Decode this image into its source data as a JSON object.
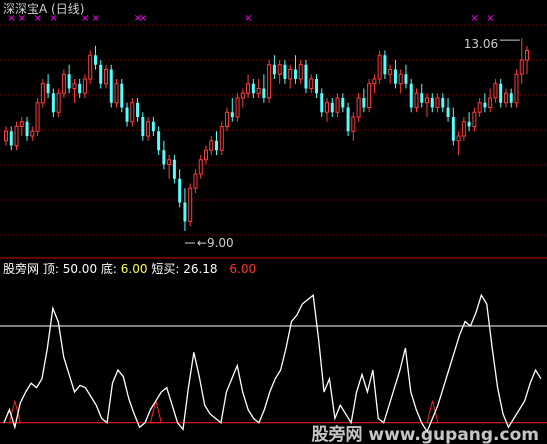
{
  "window": {
    "title": "深深宝A (日线)",
    "watermark": "股旁网 www.gupang.com"
  },
  "indicator_bar": {
    "name": "股旁网",
    "top_label": "顶:",
    "top_value": "50.00",
    "bottom_label": "底:",
    "bottom_value": "6.00",
    "short_label": "短买:",
    "short_value": "26.18",
    "extra_value": "6.00"
  },
  "colors": {
    "background": "#000000",
    "up_candle": "#ff3b3b",
    "down_candle": "#54ffff",
    "grid": "#8b0000",
    "indicator_line": "#ffffff",
    "marker": "#ff00ff",
    "bottom_fill": "#ff2020",
    "top_color": "#ffffff",
    "bottom_color": "#ffff40",
    "extra_color": "#ff3030"
  },
  "chart_data": [
    {
      "type": "candlestick",
      "title": "深深宝A (日线)",
      "annotations": [
        {
          "text": "13.06",
          "kind": "high"
        },
        {
          "text": "9.00",
          "kind": "low"
        }
      ],
      "ylim": [
        8.6,
        13.4
      ],
      "grid": true,
      "series": [
        {
          "values": [
            [
              10.9,
              11.2,
              10.8,
              11.1
            ],
            [
              11.1,
              11.2,
              10.7,
              10.8
            ],
            [
              10.8,
              11.3,
              10.7,
              11.2
            ],
            [
              11.2,
              11.4,
              11.0,
              11.3
            ],
            [
              11.3,
              11.4,
              10.9,
              11.0
            ],
            [
              11.0,
              11.2,
              10.9,
              11.1
            ],
            [
              11.1,
              11.8,
              11.0,
              11.7
            ],
            [
              11.7,
              12.2,
              11.6,
              12.1
            ],
            [
              12.1,
              12.3,
              11.8,
              11.9
            ],
            [
              11.9,
              12.0,
              11.4,
              11.5
            ],
            [
              11.5,
              12.0,
              11.4,
              11.9
            ],
            [
              11.9,
              12.4,
              11.8,
              12.3
            ],
            [
              12.3,
              12.5,
              11.9,
              12.0
            ],
            [
              12.0,
              12.2,
              11.7,
              12.1
            ],
            [
              12.1,
              12.2,
              11.8,
              11.9
            ],
            [
              11.9,
              12.3,
              11.8,
              12.2
            ],
            [
              12.2,
              12.8,
              12.1,
              12.7
            ],
            [
              12.7,
              12.9,
              12.4,
              12.5
            ],
            [
              12.5,
              12.6,
              12.0,
              12.1
            ],
            [
              12.1,
              12.5,
              12.0,
              12.4
            ],
            [
              12.4,
              12.5,
              11.6,
              11.7
            ],
            [
              11.7,
              12.2,
              11.6,
              12.1
            ],
            [
              12.1,
              12.2,
              11.5,
              11.6
            ],
            [
              11.6,
              11.7,
              11.2,
              11.3
            ],
            [
              11.3,
              11.8,
              11.2,
              11.7
            ],
            [
              11.7,
              11.8,
              11.3,
              11.4
            ],
            [
              11.4,
              11.5,
              10.9,
              11.0
            ],
            [
              11.0,
              11.4,
              10.9,
              11.3
            ],
            [
              11.3,
              11.4,
              11.0,
              11.1
            ],
            [
              11.1,
              11.2,
              10.6,
              10.7
            ],
            [
              10.7,
              10.9,
              10.3,
              10.4
            ],
            [
              10.4,
              10.6,
              10.1,
              10.5
            ],
            [
              10.5,
              10.6,
              10.0,
              10.1
            ],
            [
              10.1,
              10.3,
              9.5,
              9.6
            ],
            [
              9.6,
              9.9,
              9.0,
              9.2
            ],
            [
              9.2,
              10.0,
              9.1,
              9.9
            ],
            [
              9.9,
              10.3,
              9.8,
              10.2
            ],
            [
              10.2,
              10.6,
              10.1,
              10.5
            ],
            [
              10.5,
              10.8,
              10.4,
              10.7
            ],
            [
              10.7,
              11.0,
              10.6,
              10.9
            ],
            [
              10.9,
              11.1,
              10.6,
              10.7
            ],
            [
              10.7,
              11.3,
              10.6,
              11.2
            ],
            [
              11.2,
              11.6,
              11.1,
              11.5
            ],
            [
              11.5,
              11.8,
              11.3,
              11.4
            ],
            [
              11.4,
              11.9,
              11.3,
              11.8
            ],
            [
              11.8,
              12.0,
              11.6,
              11.9
            ],
            [
              11.9,
              12.3,
              11.8,
              12.1
            ],
            [
              12.1,
              12.2,
              11.8,
              11.9
            ],
            [
              11.9,
              12.2,
              11.8,
              12.0
            ],
            [
              12.0,
              12.3,
              11.7,
              11.8
            ],
            [
              11.8,
              12.6,
              11.7,
              12.5
            ],
            [
              12.5,
              12.7,
              12.2,
              12.3
            ],
            [
              12.3,
              12.6,
              12.1,
              12.5
            ],
            [
              12.5,
              12.6,
              12.1,
              12.2
            ],
            [
              12.2,
              12.5,
              12.0,
              12.4
            ],
            [
              12.4,
              12.7,
              12.1,
              12.2
            ],
            [
              12.2,
              12.6,
              12.1,
              12.5
            ],
            [
              12.5,
              12.6,
              11.9,
              12.0
            ],
            [
              12.0,
              12.3,
              11.9,
              12.2
            ],
            [
              12.2,
              12.3,
              11.8,
              11.9
            ],
            [
              11.9,
              12.0,
              11.4,
              11.5
            ],
            [
              11.5,
              11.8,
              11.3,
              11.7
            ],
            [
              11.7,
              11.8,
              11.4,
              11.5
            ],
            [
              11.5,
              11.9,
              11.4,
              11.8
            ],
            [
              11.8,
              11.9,
              11.5,
              11.6
            ],
            [
              11.6,
              11.7,
              11.0,
              11.1
            ],
            [
              11.1,
              11.5,
              10.9,
              11.4
            ],
            [
              11.4,
              11.9,
              11.3,
              11.8
            ],
            [
              11.8,
              12.0,
              11.5,
              11.6
            ],
            [
              11.6,
              12.2,
              11.5,
              12.1
            ],
            [
              12.1,
              12.3,
              11.9,
              12.2
            ],
            [
              12.2,
              12.8,
              12.1,
              12.7
            ],
            [
              12.7,
              12.8,
              12.2,
              12.3
            ],
            [
              12.3,
              12.5,
              12.1,
              12.4
            ],
            [
              12.4,
              12.6,
              12.0,
              12.1
            ],
            [
              12.1,
              12.4,
              11.9,
              12.3
            ],
            [
              12.3,
              12.5,
              12.0,
              12.1
            ],
            [
              12.1,
              12.2,
              11.5,
              11.6
            ],
            [
              11.6,
              12.0,
              11.5,
              11.9
            ],
            [
              11.9,
              12.1,
              11.6,
              11.7
            ],
            [
              11.7,
              11.9,
              11.4,
              11.8
            ],
            [
              11.8,
              11.9,
              11.5,
              11.6
            ],
            [
              11.6,
              11.9,
              11.5,
              11.8
            ],
            [
              11.8,
              11.9,
              11.5,
              11.6
            ],
            [
              11.6,
              11.8,
              11.3,
              11.4
            ],
            [
              11.4,
              11.6,
              10.8,
              10.9
            ],
            [
              10.9,
              11.1,
              10.6,
              11.0
            ],
            [
              11.0,
              11.4,
              10.9,
              11.3
            ],
            [
              11.3,
              11.5,
              11.1,
              11.2
            ],
            [
              11.2,
              11.6,
              11.1,
              11.5
            ],
            [
              11.5,
              11.8,
              11.4,
              11.7
            ],
            [
              11.7,
              11.9,
              11.5,
              11.6
            ],
            [
              11.6,
              12.0,
              11.5,
              11.8
            ],
            [
              11.8,
              12.2,
              11.7,
              12.1
            ],
            [
              12.1,
              12.2,
              11.6,
              11.7
            ],
            [
              11.7,
              12.0,
              11.6,
              11.9
            ],
            [
              11.9,
              12.0,
              11.6,
              11.7
            ],
            [
              11.7,
              12.4,
              11.6,
              12.3
            ],
            [
              12.3,
              13.06,
              12.1,
              12.6
            ],
            [
              12.6,
              12.9,
              12.3,
              12.8
            ]
          ]
        }
      ]
    },
    {
      "type": "line",
      "ylim": [
        0,
        70
      ],
      "reference_lines": [
        50,
        6
      ],
      "series": [
        {
          "values": [
            6,
            12,
            4,
            15,
            20,
            24,
            22,
            26,
            40,
            58,
            52,
            36,
            28,
            20,
            23,
            22,
            18,
            14,
            8,
            6,
            24,
            30,
            27,
            17,
            10,
            4,
            6,
            12,
            16,
            20,
            22,
            14,
            6,
            3,
            22,
            38,
            27,
            14,
            10,
            8,
            6,
            20,
            26,
            32,
            20,
            12,
            8,
            6,
            12,
            20,
            26,
            30,
            40,
            52,
            55,
            60,
            62,
            64,
            44,
            20,
            26,
            8,
            14,
            10,
            6,
            20,
            28,
            20,
            30,
            8,
            6,
            14,
            22,
            30,
            40,
            20,
            12,
            6,
            2,
            8,
            14,
            22,
            30,
            38,
            46,
            52,
            50,
            56,
            64,
            60,
            40,
            22,
            10,
            4,
            8,
            12,
            16,
            24,
            30,
            26
          ]
        }
      ]
    }
  ]
}
